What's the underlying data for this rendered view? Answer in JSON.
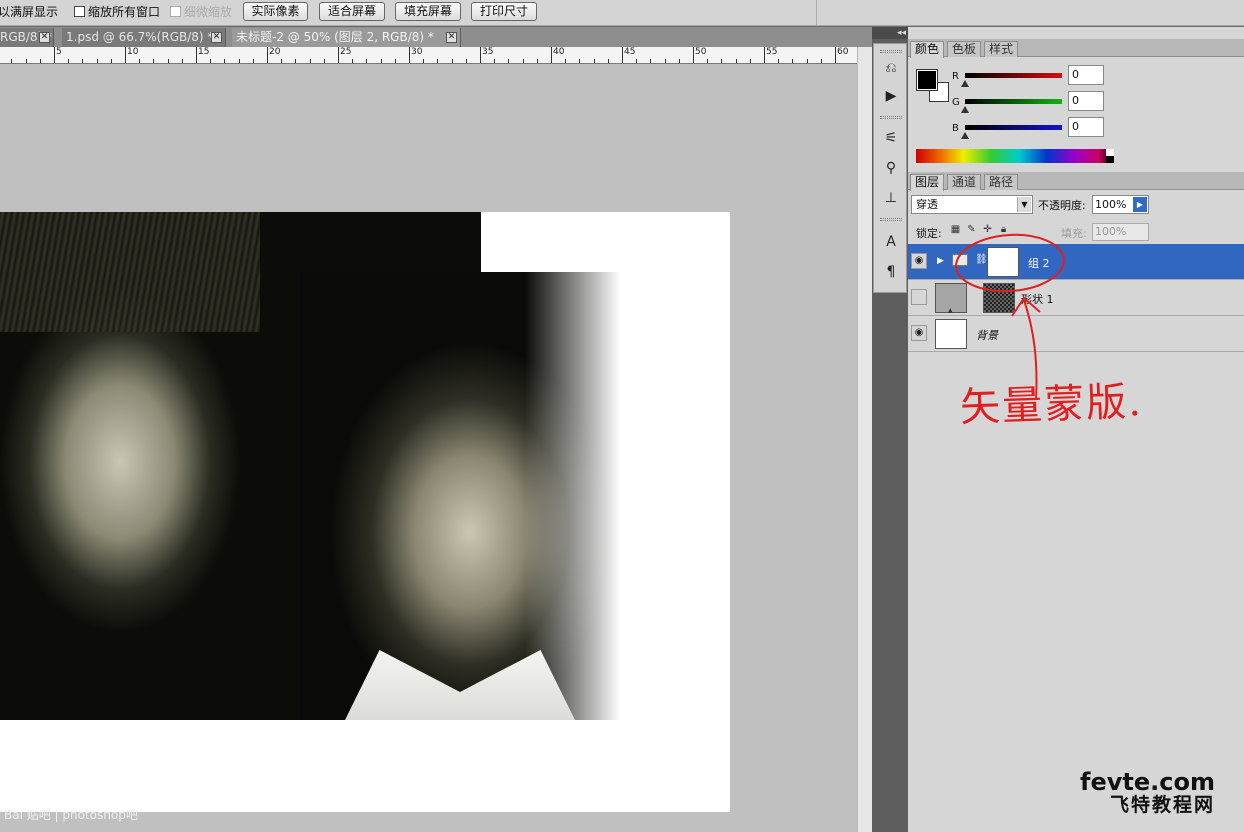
{
  "options_bar": {
    "fit_all_label": "以满屏显示",
    "zoom_all_windows": "缩放所有窗口",
    "scrubby_zoom": "细微缩放",
    "actual_pixels": "实际像素",
    "fit_screen": "适合屏幕",
    "fill_screen": "填充屏幕",
    "print_size": "打印尺寸"
  },
  "doc_tabs": [
    {
      "title": "RGB/8) *"
    },
    {
      "title": "1.psd @ 66.7%(RGB/8) *"
    },
    {
      "title": "未标题-2 @ 50% (图层 2, RGB/8) *"
    }
  ],
  "ruler": {
    "labels": [
      "5",
      "10",
      "15",
      "20",
      "25",
      "30",
      "35",
      "40",
      "45",
      "50",
      "55",
      "60"
    ]
  },
  "color_panel": {
    "tabs": [
      "颜色",
      "色板",
      "样式"
    ],
    "active_tab": "颜色",
    "channels": [
      {
        "label": "R",
        "value": "0",
        "color": "#d01010"
      },
      {
        "label": "G",
        "value": "0",
        "color": "#12b312"
      },
      {
        "label": "B",
        "value": "0",
        "color": "#1414c8"
      }
    ],
    "foreground": "#000000",
    "background": "#ffffff"
  },
  "layers_panel": {
    "tabs": [
      "图层",
      "通道",
      "路径"
    ],
    "active_tab": "图层",
    "blend_mode": "穿透",
    "opacity_label": "不透明度:",
    "opacity_value": "100%",
    "lock_label": "锁定:",
    "fill_label": "填充:",
    "fill_value": "100%",
    "layers": [
      {
        "name": "组 2",
        "visible": true,
        "selected": true,
        "type": "group"
      },
      {
        "name": "形状 1",
        "visible": false,
        "selected": false,
        "type": "shape"
      },
      {
        "name": "背景",
        "visible": true,
        "selected": false,
        "type": "background"
      }
    ]
  },
  "annotation": {
    "text": "矢量蒙版.",
    "color": "#e02020"
  },
  "watermark": {
    "text": "Bai 贴吧 | photoshop吧"
  },
  "brand": {
    "line1": "fevte.com",
    "line2": "飞特教程网"
  }
}
